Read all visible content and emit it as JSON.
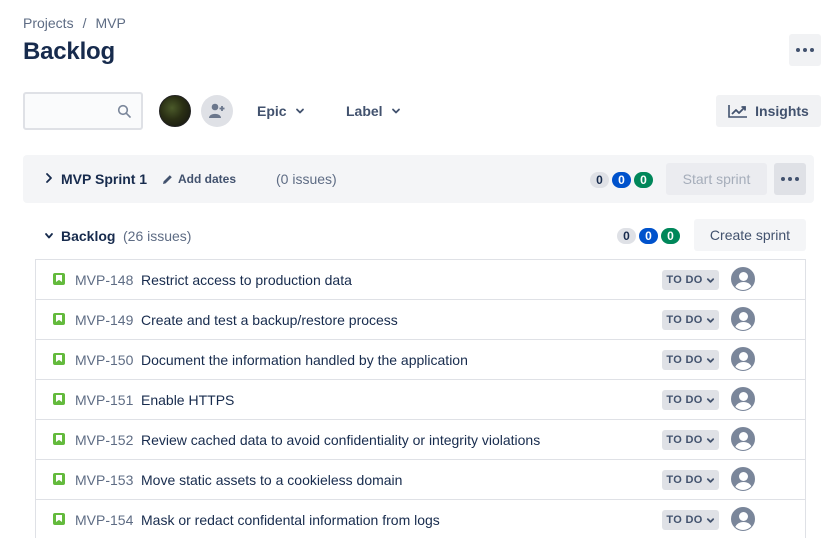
{
  "breadcrumb": {
    "project": "Projects",
    "separator": "/",
    "current": "MVP"
  },
  "page_title": "Backlog",
  "toolbar": {
    "search_placeholder": "",
    "filters": [
      {
        "label": "Epic",
        "icon": "chevron-down-icon"
      },
      {
        "label": "Label",
        "icon": "chevron-down-icon"
      }
    ],
    "insights_label": "Insights"
  },
  "sprint": {
    "name": "MVP Sprint 1",
    "add_dates_label": "Add dates",
    "issue_count": "(0 issues)",
    "badges": [
      "0",
      "0",
      "0"
    ],
    "start_label": "Start sprint"
  },
  "backlog": {
    "name": "Backlog",
    "issue_count": "(26 issues)",
    "badges": [
      "0",
      "0",
      "0"
    ],
    "create_sprint_label": "Create sprint",
    "issues": [
      {
        "key": "MVP-148",
        "summary": "Restrict access to production data",
        "status": "TO DO"
      },
      {
        "key": "MVP-149",
        "summary": "Create and test a backup/restore process",
        "status": "TO DO"
      },
      {
        "key": "MVP-150",
        "summary": "Document the information handled by the application",
        "status": "TO DO"
      },
      {
        "key": "MVP-151",
        "summary": "Enable HTTPS",
        "status": "TO DO"
      },
      {
        "key": "MVP-152",
        "summary": "Review cached data to avoid confidentiality or integrity violations",
        "status": "TO DO"
      },
      {
        "key": "MVP-153",
        "summary": "Move static assets to a cookieless domain",
        "status": "TO DO"
      },
      {
        "key": "MVP-154",
        "summary": "Mask or redact confidental information from logs",
        "status": "TO DO"
      }
    ]
  },
  "colors": {
    "badge_grey": "#dfe1e6",
    "badge_blue": "#0052cc",
    "badge_green": "#00875a",
    "story_green": "#63ba3c"
  }
}
